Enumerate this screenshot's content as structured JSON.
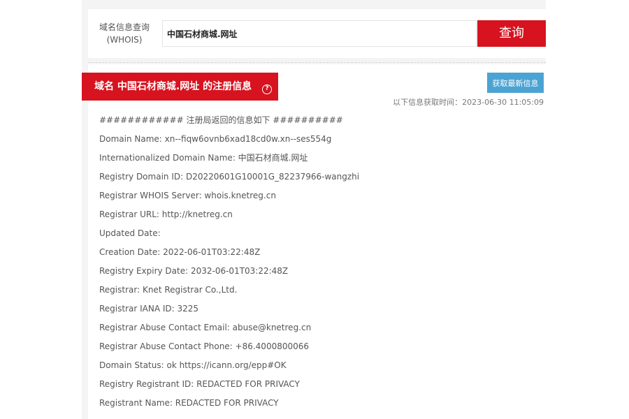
{
  "search": {
    "label_line1": "域名信息查询",
    "label_line2": "(WHOIS)",
    "input_value": "中国石材商城.网址",
    "button_label": "查询"
  },
  "result": {
    "title": "域名 中国石材商城.网址 的注册信息",
    "help_icon": "question-circle",
    "refresh_label": "获取最新信息",
    "fetch_time": "以下信息获取时间：2023-06-30 11:05:09",
    "lines": [
      "############ 注册局返回的信息如下 ##########",
      "Domain Name: xn--fiqw6ovnb6xad18cd0w.xn--ses554g",
      "Internationalized Domain Name: 中国石材商城.网址",
      "Registry Domain ID: D20220601G10001G_82237966-wangzhi",
      "Registrar WHOIS Server: whois.knetreg.cn",
      "Registrar URL: http://knetreg.cn",
      "Updated Date:",
      "Creation Date: 2022-06-01T03:22:48Z",
      "Registry Expiry Date: 2032-06-01T03:22:48Z",
      "Registrar: Knet Registrar Co.,Ltd.",
      "Registrar IANA ID: 3225",
      "Registrar Abuse Contact Email: abuse@knetreg.cn",
      "Registrar Abuse Contact Phone: +86.4000800066",
      "Domain Status: ok https://icann.org/epp#OK",
      "Registry Registrant ID: REDACTED FOR PRIVACY",
      "Registrant Name: REDACTED FOR PRIVACY"
    ]
  },
  "colors": {
    "brand_red": "#d6131f",
    "refresh_blue": "#4ba3d4"
  }
}
